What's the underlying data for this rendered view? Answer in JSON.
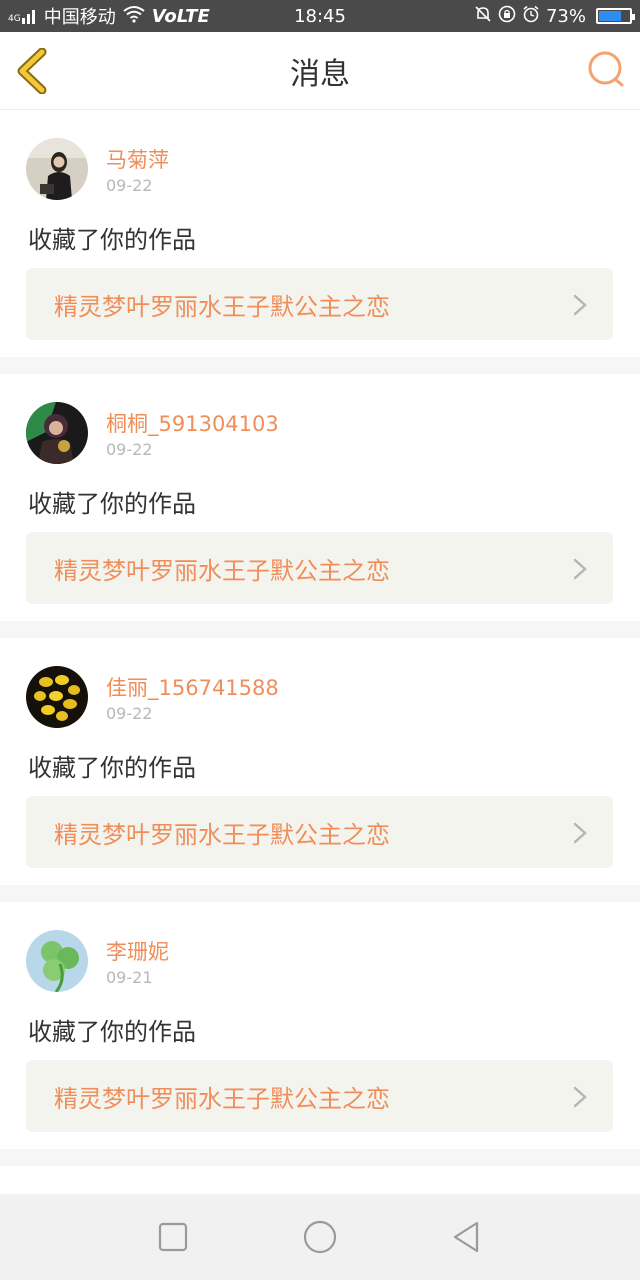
{
  "status_bar": {
    "signal_tag": "4G",
    "carrier": "中国移动",
    "volte": "VoLTE",
    "time": "18:45",
    "battery_percent": "73%",
    "battery_level": 0.73
  },
  "nav": {
    "title": "消息"
  },
  "messages": [
    {
      "username": "马菊萍",
      "date": "09-22",
      "action": "收藏了你的作品",
      "work_title": "精灵梦叶罗丽水王子默公主之恋"
    },
    {
      "username": "桐桐_591304103",
      "date": "09-22",
      "action": "收藏了你的作品",
      "work_title": "精灵梦叶罗丽水王子默公主之恋"
    },
    {
      "username": "佳丽_156741588",
      "date": "09-22",
      "action": "收藏了你的作品",
      "work_title": "精灵梦叶罗丽水王子默公主之恋"
    },
    {
      "username": "李珊妮",
      "date": "09-21",
      "action": "收藏了你的作品",
      "work_title": "精灵梦叶罗丽水王子默公主之恋"
    }
  ],
  "colors": {
    "accent": "#f08e5a",
    "back_arrow": "#e8b830",
    "status_bar_bg": "#4a4a4a"
  },
  "icons": {
    "back": "chevron-left-icon",
    "search": "search-icon",
    "link_arrow": "chevron-right-icon",
    "sys_recents": "square-icon",
    "sys_home": "circle-icon",
    "sys_back": "triangle-back-icon"
  }
}
